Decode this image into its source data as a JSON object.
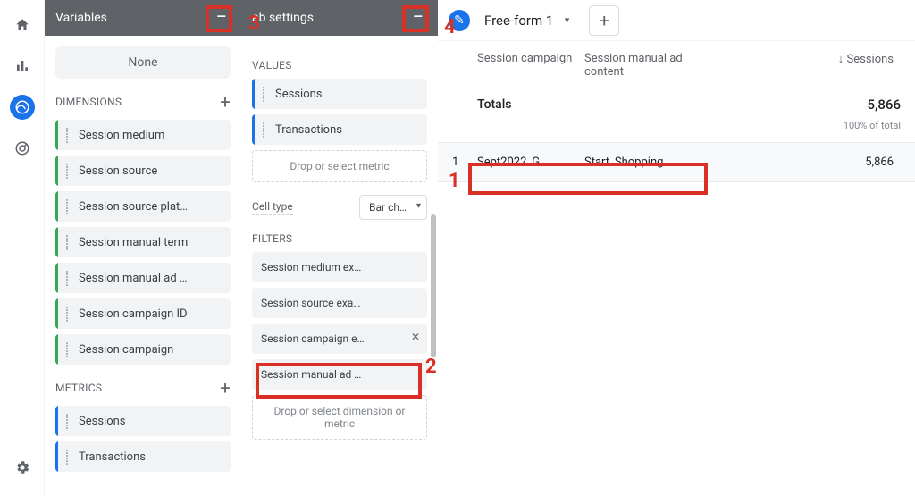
{
  "panels": {
    "variables": {
      "title": "Variables",
      "segments_none": "None"
    },
    "tabsettings": {
      "title": "ab settings"
    }
  },
  "dimensions": {
    "label": "DIMENSIONS",
    "items": [
      "Session medium",
      "Session source",
      "Session source plat…",
      "Session manual term",
      "Session manual ad …",
      "Session campaign ID",
      "Session campaign"
    ]
  },
  "metrics": {
    "label": "METRICS",
    "items": [
      "Sessions",
      "Transactions"
    ]
  },
  "values": {
    "label": "VALUES",
    "items": [
      "Sessions",
      "Transactions"
    ],
    "drop": "Drop or select metric"
  },
  "celltype": {
    "label": "Cell type",
    "value": "Bar ch…"
  },
  "filters": {
    "label": "FILTERS",
    "items": [
      "Session medium ex…",
      "Session source exa…",
      "Session campaign e…",
      "Session manual ad …"
    ],
    "drop": "Drop or select dimension or metric"
  },
  "report": {
    "tabname": "Free-form 1",
    "col_a": "Session campaign",
    "col_b": "Session manual ad content",
    "col_c": "Sessions",
    "totals_label": "Totals",
    "totals_value": "5,866",
    "totals_sub": "100% of total",
    "row_index": "1",
    "row_a": "Sept2022_G…",
    "row_b": "Start_Shopping_…",
    "row_c": "5,866"
  },
  "annotations": {
    "n1": "1",
    "n2": "2",
    "n3": "3",
    "n4": "4"
  },
  "chart_data": {
    "type": "table",
    "columns": [
      "Session campaign",
      "Session manual ad content",
      "Sessions"
    ],
    "totals": {
      "Sessions": 5866,
      "note": "100% of total"
    },
    "rows": [
      {
        "Session campaign": "Sept2022_G…",
        "Session manual ad content": "Start_Shopping_…",
        "Sessions": 5866
      }
    ],
    "sort": {
      "column": "Sessions",
      "dir": "desc"
    }
  }
}
